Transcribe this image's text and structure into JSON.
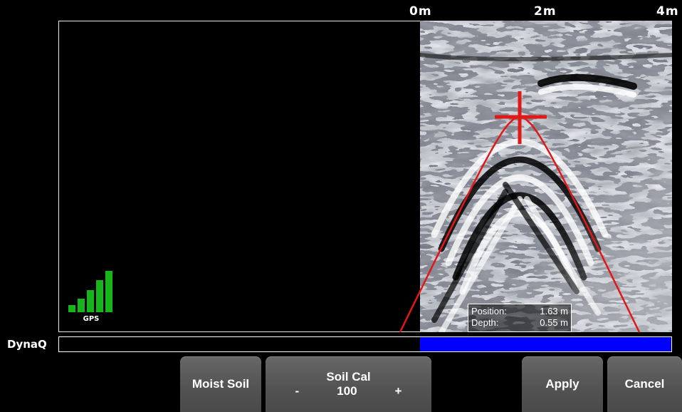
{
  "scale": {
    "labels": [
      "0m",
      "2m",
      "4m"
    ]
  },
  "gps": {
    "label": "GPS",
    "signal_bars": 5
  },
  "readout": {
    "position_label": "Position:",
    "position_value": "1.63 m",
    "depth_label": "Depth:",
    "depth_value": "0.55 m"
  },
  "dynaq": {
    "label": "DynaQ",
    "fill_fraction": 0.41
  },
  "buttons": {
    "moist_soil": "Moist Soil",
    "soil_cal_title": "Soil Cal",
    "soil_cal_minus": "-",
    "soil_cal_value": "100",
    "soil_cal_plus": "+",
    "apply": "Apply",
    "cancel": "Cancel"
  },
  "colors": {
    "gps_bar": "#15b51b",
    "dynaq_fill": "#0000ff",
    "marker": "#e01818",
    "button": "#5a5a5a"
  }
}
